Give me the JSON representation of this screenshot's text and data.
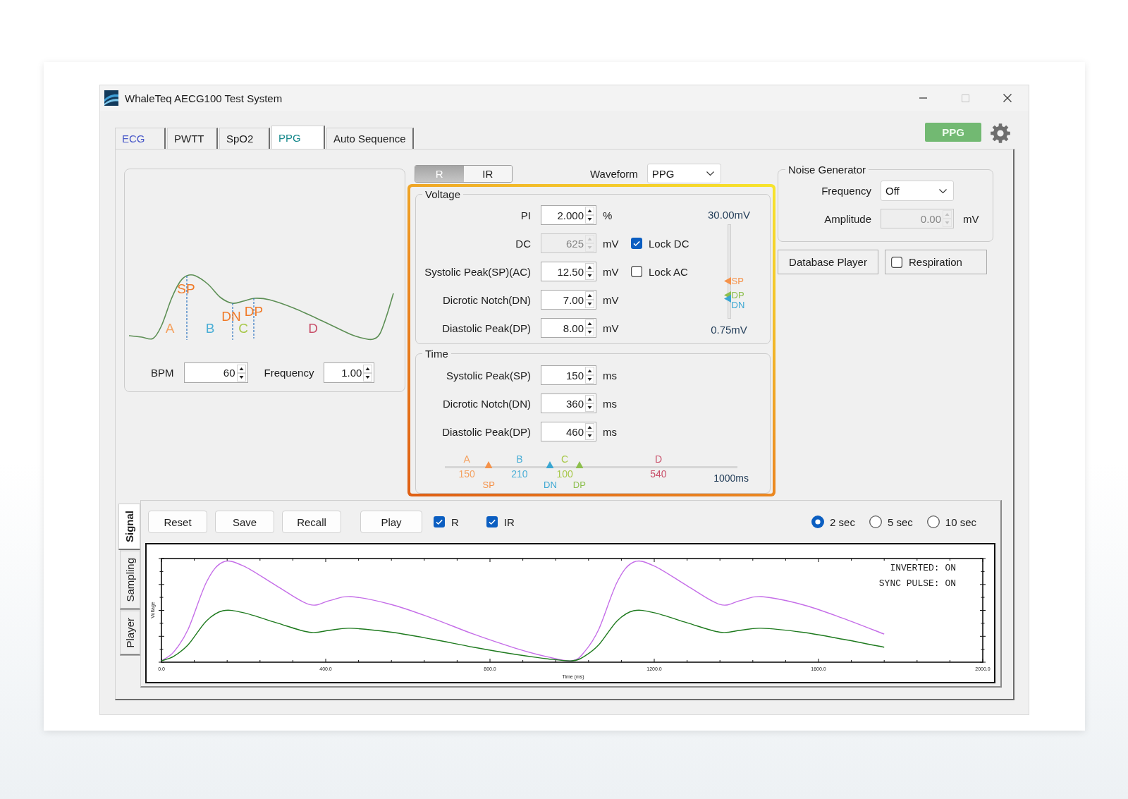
{
  "window": {
    "title": "WhaleTeq AECG100 Test System"
  },
  "tabs": [
    {
      "label": "ECG",
      "selected": false,
      "color": "#4656c8"
    },
    {
      "label": "PWTT",
      "selected": false,
      "color": "#1b1b1b"
    },
    {
      "label": "SpO2",
      "selected": false,
      "color": "#1b1b1b"
    },
    {
      "label": "PPG",
      "selected": true,
      "color": "#16898c"
    },
    {
      "label": "Auto Sequence",
      "selected": false,
      "color": "#1b1b1b"
    }
  ],
  "mode_indicator": "PPG",
  "waveform_diagram": {
    "labels": [
      {
        "text": "SP",
        "color": "#f07a28"
      },
      {
        "text": "A",
        "color": "#f4a261"
      },
      {
        "text": "B",
        "color": "#4aaed6"
      },
      {
        "text": "DN",
        "color": "#f07a28"
      },
      {
        "text": "C",
        "color": "#a8c84a"
      },
      {
        "text": "DP",
        "color": "#f07a28"
      },
      {
        "text": "D",
        "color": "#c9506a"
      }
    ]
  },
  "pulse_settings": [
    {
      "label": "BPM",
      "value": "60"
    },
    {
      "label": "Frequency",
      "value": "1.00"
    }
  ],
  "channel_toggle": [
    {
      "label": "R",
      "selected": true
    },
    {
      "label": "IR",
      "selected": false
    }
  ],
  "waveform_select": {
    "label": "Waveform",
    "value": "PPG"
  },
  "voltage": {
    "title": "Voltage",
    "rows": [
      {
        "label": "PI",
        "value": "2.000",
        "unit": "%",
        "disabled": false
      },
      {
        "label": "DC",
        "value": "625",
        "unit": "mV",
        "disabled": true,
        "lock": {
          "label": "Lock DC",
          "checked": true
        }
      },
      {
        "label": "Systolic Peak(SP)(AC)",
        "value": "12.50",
        "unit": "mV",
        "disabled": false,
        "lock": {
          "label": "Lock AC",
          "checked": false
        }
      },
      {
        "label": "Dicrotic Notch(DN)",
        "value": "7.00",
        "unit": "mV",
        "disabled": false
      },
      {
        "label": "Diastolic Peak(DP)",
        "value": "8.00",
        "unit": "mV",
        "disabled": false
      }
    ],
    "scale": {
      "max_label": "30.00mV",
      "min_label": "0.75mV",
      "markers": [
        {
          "label": "SP",
          "color": "#f5924a",
          "level": 0.4
        },
        {
          "label": "DP",
          "color": "#8dbf4e",
          "level": 0.25
        },
        {
          "label": "DN",
          "color": "#3aa6d2",
          "level": 0.21
        }
      ]
    }
  },
  "time": {
    "title": "Time",
    "rows": [
      {
        "label": "Systolic Peak(SP)",
        "value": "150",
        "unit": "ms"
      },
      {
        "label": "Dicrotic Notch(DN)",
        "value": "360",
        "unit": "ms"
      },
      {
        "label": "Diastolic Peak(DP)",
        "value": "460",
        "unit": "ms"
      }
    ],
    "timeline": {
      "segments": [
        {
          "label": "A",
          "value": "150",
          "color": "#f4a261"
        },
        {
          "label": "B",
          "value": "210",
          "color": "#4aaed6"
        },
        {
          "label": "C",
          "value": "100",
          "color": "#a8c84a"
        },
        {
          "label": "D",
          "value": "540",
          "color": "#c9506a"
        }
      ],
      "markers": [
        {
          "label": "SP",
          "color": "#f5924a",
          "level": 0.15
        },
        {
          "label": "DN",
          "color": "#3aa6d2",
          "level": 0.36
        },
        {
          "label": "DP",
          "color": "#8dbf4e",
          "level": 0.46
        }
      ],
      "end_label": "1000ms"
    }
  },
  "noise_generator": {
    "title": "Noise Generator",
    "frequency": {
      "label": "Frequency",
      "value": "Off"
    },
    "amplitude": {
      "label": "Amplitude",
      "value": "0.00",
      "unit": "mV",
      "disabled": true
    }
  },
  "database_player_button": "Database Player",
  "respiration": {
    "label": "Respiration",
    "checked": false
  },
  "side_tabs": [
    {
      "label": "Signal",
      "selected": true
    },
    {
      "label": "Sampling",
      "selected": false
    },
    {
      "label": "Player",
      "selected": false
    }
  ],
  "toolbar_buttons": [
    "Reset",
    "Save",
    "Recall",
    "Play"
  ],
  "trace_channels": [
    {
      "label": "R",
      "checked": true
    },
    {
      "label": "IR",
      "checked": true
    }
  ],
  "time_window": [
    {
      "label": "2 sec",
      "selected": true
    },
    {
      "label": "5 sec",
      "selected": false
    },
    {
      "label": "10 sec",
      "selected": false
    }
  ],
  "signal_plot": {
    "xlabel": "Time (ms)",
    "ylabel": "Voltage",
    "x_tick_labels": [
      "0.0",
      "400.0",
      "800.0",
      "1200.0",
      "1600.0",
      "2000.0"
    ],
    "status_lines": [
      "INVERTED: ON",
      "SYNC PULSE: ON"
    ]
  }
}
